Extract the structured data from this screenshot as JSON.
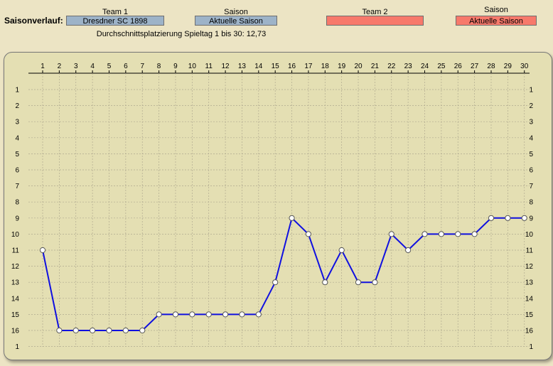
{
  "header": {
    "title": "Saisonverlauf:",
    "team1_label": "Team 1",
    "team1_value": "Dresdner SC 1898",
    "season1_label": "Saison",
    "season1_value": "Aktuelle Saison",
    "team2_label": "Team 2",
    "team2_value": "",
    "season2_label": "Saison",
    "season2_value": "Aktuelle Saison",
    "average_text": "Durchschnittsplatzierung Spieltag 1 bis 30: 12,73"
  },
  "colors": {
    "team1_field": "#9db3c8",
    "team2_field": "#f7796b",
    "line": "#1010e0",
    "panel": "#e4dfb3"
  },
  "chart_data": {
    "type": "line",
    "title": "",
    "xlabel": "",
    "ylabel": "",
    "x": [
      1,
      2,
      3,
      4,
      5,
      6,
      7,
      8,
      9,
      10,
      11,
      12,
      13,
      14,
      15,
      16,
      17,
      18,
      19,
      20,
      21,
      22,
      23,
      24,
      25,
      26,
      27,
      28,
      29,
      30
    ],
    "y_ticks": [
      "1",
      "2",
      "3",
      "4",
      "5",
      "6",
      "7",
      "8",
      "9",
      "10",
      "11",
      "12",
      "13",
      "14",
      "15",
      "16",
      "1"
    ],
    "y_right_ticks": [
      "1",
      "2",
      "3",
      "4",
      "5",
      "6",
      "7",
      "8",
      "9",
      "10",
      "11",
      "12",
      "13",
      "14",
      "15",
      "16",
      "1"
    ],
    "ylim": [
      1,
      17
    ],
    "y_inverted": true,
    "grid": true,
    "series": [
      {
        "name": "Dresdner SC 1898",
        "values": [
          11,
          16,
          16,
          16,
          16,
          16,
          16,
          15,
          15,
          15,
          15,
          15,
          15,
          15,
          13,
          9,
          10,
          13,
          11,
          13,
          13,
          10,
          11,
          10,
          10,
          10,
          10,
          9,
          9,
          9
        ]
      }
    ]
  }
}
